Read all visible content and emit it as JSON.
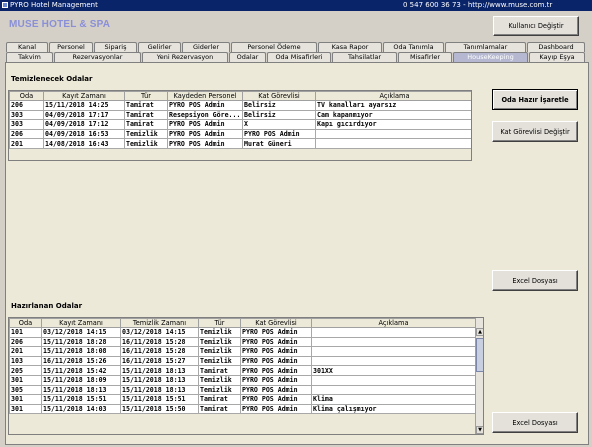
{
  "window": {
    "title": "PYRO Hotel Management",
    "contact": "0 547 600 36 73  -  http://www.muse.com.tr"
  },
  "brand": "MUSE HOTEL & SPA",
  "buttons": {
    "change_user": "Kullanıcı Değiştir",
    "mark_ready": "Oda Hazır İşaretle",
    "change_floor_staff": "Kat Görevlisi Değiştir",
    "excel_1": "Excel Dosyası",
    "excel_2": "Excel Dosyası"
  },
  "tabs_row1": [
    "Kanal",
    "Personel",
    "Sipariş",
    "Gelirler",
    "Giderler",
    "Personel Ödeme",
    "Kasa Rapor",
    "Oda Tanımla",
    "Tanımlamalar",
    "Dashboard"
  ],
  "tabs_row2": [
    "Takvim",
    "Rezervasyonlar",
    "Yeni Rezervasyon",
    "Odalar",
    "Oda Misafirleri",
    "Tahsilatlar",
    "Misafirler",
    "HouseKeeping",
    "Kayıp Eşya"
  ],
  "cleaning": {
    "title": "Temizlenecek Odalar",
    "headers": [
      "Oda",
      "Kayıt Zamanı",
      "Tür",
      "Kaydeden Personel",
      "Kat Görevlisi",
      "Açıklama"
    ],
    "rows": [
      [
        "206",
        "15/11/2018 14:25",
        "Tamirat",
        "PYRO POS Admin",
        "Belirsiz",
        "TV kanalları ayarsız"
      ],
      [
        "303",
        "04/09/2018 17:17",
        "Tamirat",
        "Resepsiyon Göre...",
        "Belirsiz",
        "Cam kapanmıyor"
      ],
      [
        "303",
        "04/09/2018 17:12",
        "Tamirat",
        "PYRO POS Admin",
        "X",
        "Kapı gıcırdıyor"
      ],
      [
        "206",
        "04/09/2018 16:53",
        "Temizlik",
        "PYRO POS Admin",
        "PYRO POS Admin",
        ""
      ],
      [
        "201",
        "14/08/2018 16:43",
        "Temizlik",
        "PYRO POS Admin",
        "Murat Güneri",
        ""
      ]
    ]
  },
  "prepared": {
    "title": "Hazırlanan Odalar",
    "headers": [
      "Oda",
      "Kayıt Zamanı",
      "Temizlik Zamanı",
      "Tür",
      "Kat Görevlisi",
      "Açıklama"
    ],
    "rows": [
      [
        "101",
        "03/12/2018 14:15",
        "03/12/2018 14:15",
        "Temizlik",
        "PYRO POS Admin",
        ""
      ],
      [
        "206",
        "15/11/2018 18:28",
        "16/11/2018 15:28",
        "Temizlik",
        "PYRO POS Admin",
        ""
      ],
      [
        "201",
        "15/11/2018 18:08",
        "16/11/2018 15:28",
        "Temizlik",
        "PYRO POS Admin",
        ""
      ],
      [
        "103",
        "16/11/2018 15:26",
        "16/11/2018 15:27",
        "Temizlik",
        "PYRO POS Admin",
        ""
      ],
      [
        "205",
        "15/11/2018 15:42",
        "15/11/2018 18:13",
        "Tamirat",
        "PYRO POS Admin",
        "301XX"
      ],
      [
        "301",
        "15/11/2018 18:09",
        "15/11/2018 18:13",
        "Temizlik",
        "PYRO POS Admin",
        ""
      ],
      [
        "305",
        "15/11/2018 18:13",
        "15/11/2018 18:13",
        "Temizlik",
        "PYRO POS Admin",
        ""
      ],
      [
        "301",
        "15/11/2018 15:51",
        "15/11/2018 15:51",
        "Tamirat",
        "PYRO POS Admin",
        "Klima"
      ],
      [
        "301",
        "15/11/2018 14:03",
        "15/11/2018 15:50",
        "Tamirat",
        "PYRO POS Admin",
        "Klima çalışmıyor"
      ]
    ]
  }
}
